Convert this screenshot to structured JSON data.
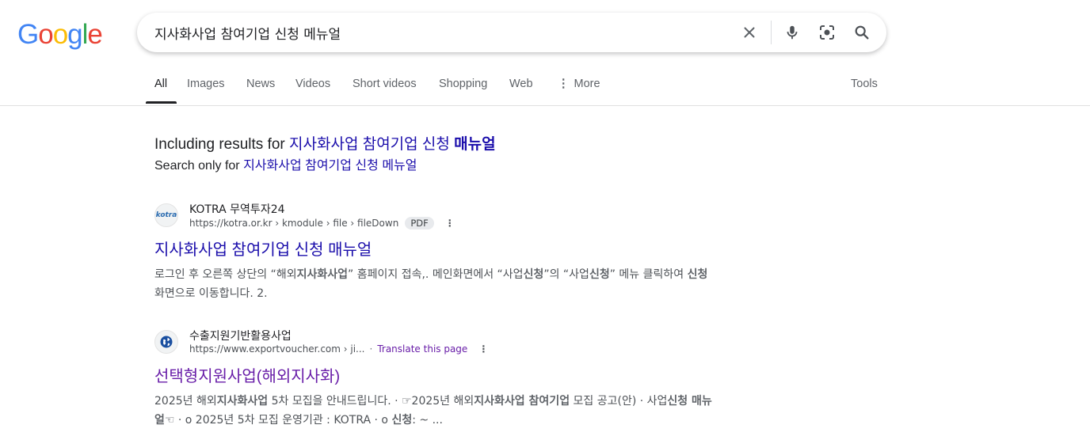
{
  "logo": [
    "G",
    "o",
    "o",
    "g",
    "l",
    "e"
  ],
  "logo_colors": [
    "#4285F4",
    "#EA4335",
    "#FBBC05",
    "#4285F4",
    "#34A853",
    "#EA4335"
  ],
  "search": {
    "query": "지사화사업 참여기업 신청 메뉴얼"
  },
  "icons": [
    "close-icon",
    "microphone-icon",
    "camera-lens-icon",
    "search-icon",
    "more-vert-icon",
    "globe-icon"
  ],
  "tabs": {
    "all": "All",
    "images": "Images",
    "news": "News",
    "videos": "Videos",
    "short_videos": "Short videos",
    "shopping": "Shopping",
    "web": "Web",
    "more": "More",
    "tools": "Tools"
  },
  "spelling": {
    "including_prefix": "Including results for",
    "including_query_plain": "지사화사업 참여기업 신청",
    "including_query_bold": "매뉴얼",
    "search_only_prefix": "Search only for",
    "search_only_query": "지사화사업 참여기업 신청 메뉴얼"
  },
  "results": [
    {
      "favicon_text": "kotra",
      "site_name": "KOTRA 무역투자24",
      "url": "https://kotra.or.kr › kmodule › file › fileDown",
      "badge": "PDF",
      "title": "지사화사업 참여기업 신청 매뉴얼",
      "snippet": [
        [
          "로그인 후 오른쪽 상단의 “해외",
          false
        ],
        [
          "지사화사업",
          true
        ],
        [
          "” 홈페이지 접속,. 메인화면에서 “사업",
          false
        ],
        [
          "신청",
          true
        ],
        [
          "”의 “사업",
          false
        ],
        [
          "신청",
          true
        ],
        [
          "” 메뉴 클릭하여 ",
          false
        ],
        [
          "신청",
          true
        ],
        [
          " 화면으로 이동합니다. 2.",
          false
        ]
      ]
    },
    {
      "site_name": "수출지원기반활용사업",
      "url": "https://www.exportvoucher.com › ji...",
      "translate": "Translate this page",
      "title": "선택형지원사업(해외지사화)",
      "snippet": [
        [
          "2025년 해외",
          false
        ],
        [
          "지사화사업",
          true
        ],
        [
          " 5차 모집을 안내드립니다. · ☞2025년 해외",
          false
        ],
        [
          "지사화사업 참여기업",
          true
        ],
        [
          " 모집 공고(안) · 사업",
          false
        ],
        [
          "신청 매뉴얼",
          true
        ],
        [
          "☜ · o 2025년 5차 모집 운영기관 : KOTRA · o ",
          false
        ],
        [
          "신청",
          true
        ],
        [
          ": ~ ...",
          false
        ]
      ]
    }
  ]
}
